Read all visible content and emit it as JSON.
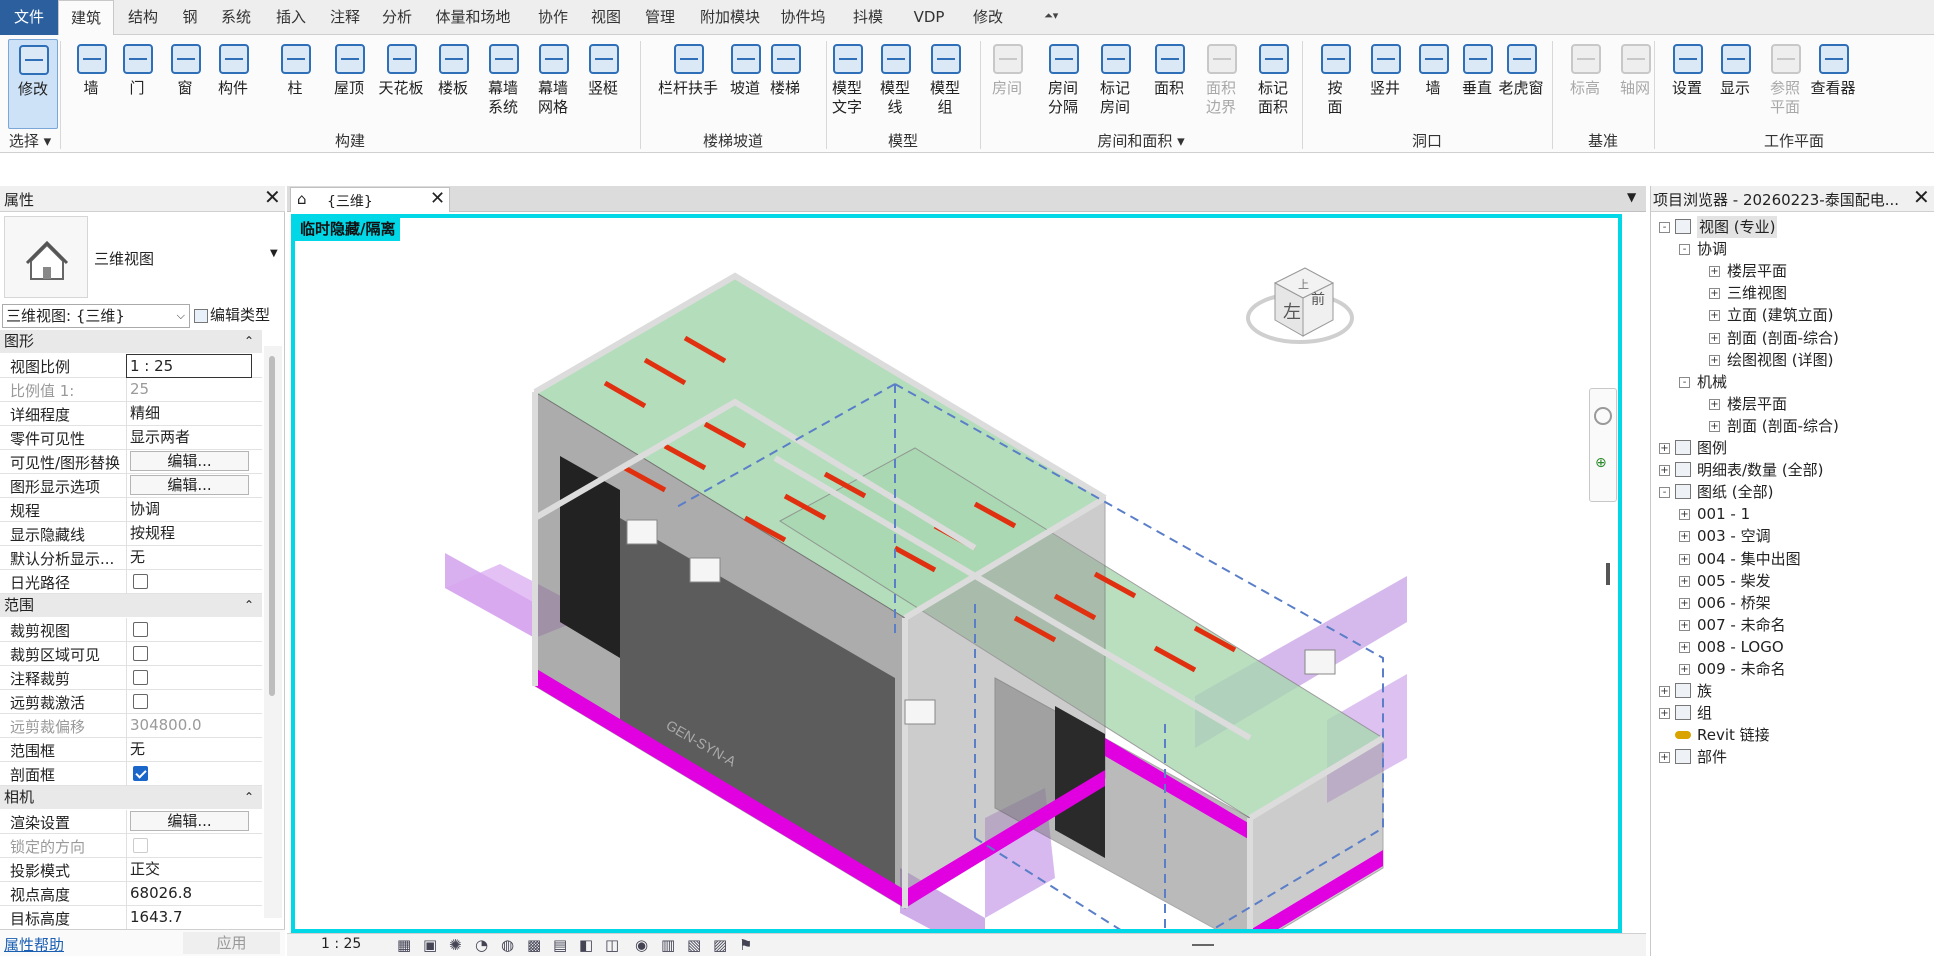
{
  "menu": {
    "tabs": [
      "文件",
      "建筑",
      "结构",
      "钢",
      "系统",
      "插入",
      "注释",
      "分析",
      "体量和场地",
      "协作",
      "视图",
      "管理",
      "附加模块",
      "协件坞",
      "抖模",
      "VDP",
      "修改"
    ],
    "active": "建筑"
  },
  "ribbon": {
    "buttons": [
      {
        "label": "修改",
        "state": "selected"
      },
      {
        "label": "墙"
      },
      {
        "label": "门"
      },
      {
        "label": "窗"
      },
      {
        "label": "构件"
      },
      {
        "label": "柱"
      },
      {
        "label": "屋顶"
      },
      {
        "label": "天花板"
      },
      {
        "label": "楼板"
      },
      {
        "label": "幕墙\n系统"
      },
      {
        "label": "幕墙\n网格"
      },
      {
        "label": "竖梃"
      },
      {
        "label": "栏杆扶手"
      },
      {
        "label": "坡道"
      },
      {
        "label": "楼梯"
      },
      {
        "label": "模型\n文字"
      },
      {
        "label": "模型\n线"
      },
      {
        "label": "模型\n组"
      },
      {
        "label": "房间",
        "state": "disabled"
      },
      {
        "label": "房间\n分隔"
      },
      {
        "label": "标记\n房间"
      },
      {
        "label": "面积"
      },
      {
        "label": "面积\n边界",
        "state": "disabled"
      },
      {
        "label": "标记\n面积"
      },
      {
        "label": "按\n面"
      },
      {
        "label": "竖井"
      },
      {
        "label": "墙"
      },
      {
        "label": "垂直"
      },
      {
        "label": "老虎窗"
      },
      {
        "label": "标高",
        "state": "disabled"
      },
      {
        "label": "轴网",
        "state": "disabled"
      },
      {
        "label": "设置"
      },
      {
        "label": "显示"
      },
      {
        "label": "参照\n平面",
        "state": "disabled"
      },
      {
        "label": "查看器"
      }
    ],
    "groups": [
      "选择",
      "构建",
      "楼梯坡道",
      "模型",
      "房间和面积",
      "洞口",
      "基准",
      "工作平面"
    ]
  },
  "properties": {
    "title": "属性",
    "type_name": "三维视图",
    "selector": "三维视图: {三维}",
    "edit_type": "编辑类型",
    "sections": [
      {
        "name": "图形",
        "rows": [
          {
            "k": "视图比例",
            "v": "1 : 25",
            "kind": "input"
          },
          {
            "k": "比例值 1:",
            "v": "25",
            "kind": "dim"
          },
          {
            "k": "详细程度",
            "v": "精细"
          },
          {
            "k": "零件可见性",
            "v": "显示两者"
          },
          {
            "k": "可见性/图形替换",
            "v": "编辑...",
            "kind": "button"
          },
          {
            "k": "图形显示选项",
            "v": "编辑...",
            "kind": "button"
          },
          {
            "k": "规程",
            "v": "协调"
          },
          {
            "k": "显示隐藏线",
            "v": "按规程"
          },
          {
            "k": "默认分析显示...",
            "v": "无"
          },
          {
            "k": "日光路径",
            "v": "",
            "kind": "check",
            "on": false
          }
        ]
      },
      {
        "name": "范围",
        "rows": [
          {
            "k": "裁剪视图",
            "v": "",
            "kind": "check",
            "on": false
          },
          {
            "k": "裁剪区域可见",
            "v": "",
            "kind": "check",
            "on": false
          },
          {
            "k": "注释裁剪",
            "v": "",
            "kind": "check",
            "on": false
          },
          {
            "k": "远剪裁激活",
            "v": "",
            "kind": "check",
            "on": false
          },
          {
            "k": "远剪裁偏移",
            "v": "304800.0",
            "kind": "dim"
          },
          {
            "k": "范围框",
            "v": "无"
          },
          {
            "k": "剖面框",
            "v": "",
            "kind": "check",
            "on": true
          }
        ]
      },
      {
        "name": "相机",
        "rows": [
          {
            "k": "渲染设置",
            "v": "编辑...",
            "kind": "button"
          },
          {
            "k": "锁定的方向",
            "v": "",
            "kind": "check",
            "on": false,
            "dim": true
          },
          {
            "k": "投影模式",
            "v": "正交"
          },
          {
            "k": "视点高度",
            "v": "68026.8"
          },
          {
            "k": "目标高度",
            "v": "1643.7"
          }
        ]
      }
    ],
    "help": "属性帮助",
    "apply": "应用"
  },
  "view": {
    "tab_title": "{三维}",
    "banner": "临时隐藏/隔离",
    "scale": "1 : 25",
    "watermark": "GEN-SYN-A",
    "cube_front": "前",
    "cube_left": "左",
    "cube_top": "上"
  },
  "browser": {
    "title": "项目浏览器 - 20260223-泰国配电...",
    "nodes": [
      {
        "label": "视图 (专业)",
        "level": 0,
        "box": "-",
        "icon": "views"
      },
      {
        "label": "协调",
        "level": 1,
        "box": "-"
      },
      {
        "label": "楼层平面",
        "level": 2,
        "box": "+"
      },
      {
        "label": "三维视图",
        "level": 2,
        "box": "+"
      },
      {
        "label": "立面 (建筑立面)",
        "level": 2,
        "box": "+"
      },
      {
        "label": "剖面 (剖面-综合)",
        "level": 2,
        "box": "+"
      },
      {
        "label": "绘图视图 (详图)",
        "level": 2,
        "box": "+"
      },
      {
        "label": "机械",
        "level": 1,
        "box": "-"
      },
      {
        "label": "楼层平面",
        "level": 2,
        "box": "+"
      },
      {
        "label": "剖面 (剖面-综合)",
        "level": 2,
        "box": "+"
      },
      {
        "label": "图例",
        "level": 0,
        "box": "+",
        "icon": "legend"
      },
      {
        "label": "明细表/数量 (全部)",
        "level": 0,
        "box": "+",
        "icon": "schedule"
      },
      {
        "label": "图纸 (全部)",
        "level": 0,
        "box": "-",
        "icon": "sheet"
      },
      {
        "label": "001 - 1",
        "level": 1,
        "box": "+"
      },
      {
        "label": "003 - 空调",
        "level": 1,
        "box": "+"
      },
      {
        "label": "004 - 集中出图",
        "level": 1,
        "box": "+"
      },
      {
        "label": "005 - 柴发",
        "level": 1,
        "box": "+"
      },
      {
        "label": "006 - 桥架",
        "level": 1,
        "box": "+"
      },
      {
        "label": "007 - 未命名",
        "level": 1,
        "box": "+"
      },
      {
        "label": "008 - LOGO",
        "level": 1,
        "box": "+"
      },
      {
        "label": "009 - 未命名",
        "level": 1,
        "box": "+"
      },
      {
        "label": "族",
        "level": 0,
        "box": "+",
        "icon": "family"
      },
      {
        "label": "组",
        "level": 0,
        "box": "+",
        "icon": "group"
      },
      {
        "label": "Revit 链接",
        "level": 0,
        "box": "",
        "icon": "link"
      },
      {
        "label": "部件",
        "level": 0,
        "box": "+",
        "icon": "assembly"
      }
    ]
  },
  "colors": {
    "accent": "#2b5f9e",
    "viewport_border": "#00d8e8",
    "banner_bg": "#00d8e8",
    "selection": "#1a66c9",
    "magenta": "#e000e0",
    "green_roof": "#a8d8b0"
  }
}
